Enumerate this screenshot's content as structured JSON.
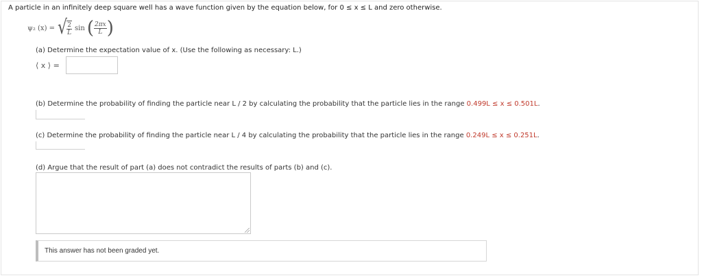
{
  "intro": {
    "text": "A particle in an infinitely deep square well has a wave function given by the equation below, for 0 ≤ x ≤ L and zero otherwise."
  },
  "equation": {
    "lhs": "ψ₂ (x) =",
    "sqrt_num": "2",
    "sqrt_den": "L",
    "func": "sin",
    "arg_num": "2πx",
    "arg_den": "L"
  },
  "part_a": {
    "question": "(a) Determine the expectation value of x. (Use the following as necessary: L.)",
    "answer_label": "⟨ x ⟩ =",
    "answer_value": ""
  },
  "part_b": {
    "question_prefix": "(b) Determine the probability of finding the particle near L / 2 by calculating the probability that the particle lies in the range ",
    "range": "0.499L ≤ x ≤ 0.501L",
    "question_suffix": ".",
    "answer_value": ""
  },
  "part_c": {
    "question_prefix": "(c) Determine the probability of finding the particle near L / 4 by calculating the probability that the particle lies in the range ",
    "range": "0.249L ≤ x ≤ 0.251L",
    "question_suffix": ".",
    "answer_value": ""
  },
  "part_d": {
    "question": "(d) Argue that the result of part (a) does not contradict the results of parts (b) and (c).",
    "answer_value": ""
  },
  "status": {
    "text": "This answer has not been graded yet."
  },
  "colors": {
    "highlight": "#c0392b",
    "border": "#c9c9c9"
  }
}
